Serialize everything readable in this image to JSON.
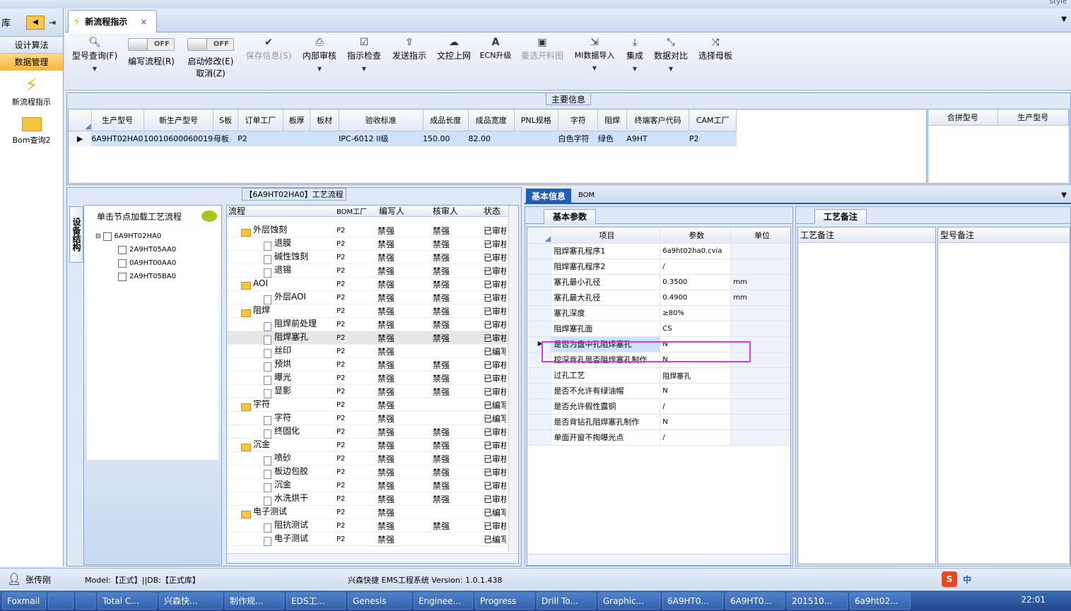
{
  "nav": {
    "top_label": "库",
    "items": [
      "设计算法",
      "数据管理"
    ],
    "tiles": [
      "新流程指示",
      "Bom查询2"
    ]
  },
  "tab": {
    "title": "新流程指示",
    "close": "×"
  },
  "ribbon": {
    "buttons": [
      {
        "label": "型号查询(F)",
        "icon": "search-icon"
      },
      {
        "label": "编写流程(R)",
        "icon": "toggle-off"
      },
      {
        "label": "启动修改(E)",
        "label2": "取消(Z)",
        "icon": "toggle-off"
      },
      {
        "label": "保存信息(S)",
        "icon": "check-icon"
      },
      {
        "label": "内部审核",
        "icon": "print-icon"
      },
      {
        "label": "指示检查",
        "icon": "checkbox-icon"
      },
      {
        "label": "发送指示",
        "icon": "upload-icon"
      },
      {
        "label": "文控上网",
        "icon": "cloud-upload-icon"
      },
      {
        "label": "ECN升级",
        "icon": "font-a-icon"
      },
      {
        "label": "重选开料图",
        "icon": "image-icon"
      },
      {
        "label": "MI数据导入",
        "icon": "import-icon"
      },
      {
        "label": "集成",
        "icon": "download-icon"
      },
      {
        "label": "数据对比",
        "icon": "compress-icon"
      },
      {
        "label": "选择母板",
        "icon": "shuffle-icon"
      }
    ],
    "toggle_off": "OFF"
  },
  "main_info": {
    "title": "主要信息",
    "headers": [
      "生产型号",
      "新生产型号",
      "S板",
      "订单工厂",
      "板厚",
      "板材",
      "验收标准",
      "成品长度",
      "成品宽度",
      "PNL规格",
      "字符",
      "阻焊",
      "终端客户代码",
      "CAM工厂"
    ],
    "row": [
      "6A9HT02HA0",
      "10010600060019",
      "母板",
      "P2",
      "",
      "",
      "IPC-6012 II级",
      "150.00",
      "82.00",
      "",
      "白色字符",
      "绿色",
      "A9HT",
      "P2"
    ],
    "side_headers": [
      "合拼型号",
      "生产型号"
    ]
  },
  "flow": {
    "title": "【6A9HT02HA0】工艺流程",
    "hint": "单击节点加载工艺流程",
    "vtab": "设备结构",
    "tree": [
      "6A9HT02HA0",
      "2A9HT05AA0",
      "0A9HT00AA0",
      "2A9HT05BA0"
    ],
    "headers": [
      "流程",
      "BOM工厂",
      "编写人",
      "核审人",
      "状态"
    ],
    "rows": [
      {
        "n": "外层蚀刻",
        "f": 1,
        "b": "P2",
        "w": "禁强",
        "h": "禁强",
        "s": "已审核"
      },
      {
        "n": "退膜",
        "f": 0,
        "b": "P2",
        "w": "禁强",
        "h": "禁强",
        "s": "已审核"
      },
      {
        "n": "碱性蚀刻",
        "f": 0,
        "b": "P2",
        "w": "禁强",
        "h": "禁强",
        "s": "已审核"
      },
      {
        "n": "退锡",
        "f": 0,
        "b": "P2",
        "w": "禁强",
        "h": "禁强",
        "s": "已审核"
      },
      {
        "n": "AOI",
        "f": 1,
        "b": "P2",
        "w": "禁强",
        "h": "禁强",
        "s": "已审核"
      },
      {
        "n": "外层AOI",
        "f": 0,
        "b": "P2",
        "w": "禁强",
        "h": "禁强",
        "s": "已审核"
      },
      {
        "n": "阻焊",
        "f": 1,
        "b": "P2",
        "w": "禁强",
        "h": "禁强",
        "s": "已审核"
      },
      {
        "n": "阻焊前处理",
        "f": 0,
        "b": "P2",
        "w": "禁强",
        "h": "禁强",
        "s": "已审核"
      },
      {
        "n": "阻焊塞孔",
        "f": 0,
        "b": "P2",
        "w": "禁强",
        "h": "禁强",
        "s": "已审核",
        "sel": 1
      },
      {
        "n": "丝印",
        "f": 0,
        "b": "P2",
        "w": "禁强",
        "h": "",
        "s": "已编写"
      },
      {
        "n": "预烘",
        "f": 0,
        "b": "P2",
        "w": "禁强",
        "h": "禁强",
        "s": "已审核"
      },
      {
        "n": "曝光",
        "f": 0,
        "b": "P2",
        "w": "禁强",
        "h": "禁强",
        "s": "已审核"
      },
      {
        "n": "显影",
        "f": 0,
        "b": "P2",
        "w": "禁强",
        "h": "禁强",
        "s": "已审核"
      },
      {
        "n": "字符",
        "f": 1,
        "b": "P2",
        "w": "禁强",
        "h": "",
        "s": "已编写"
      },
      {
        "n": "字符",
        "f": 0,
        "b": "P2",
        "w": "禁强",
        "h": "",
        "s": "已编写"
      },
      {
        "n": "终固化",
        "f": 0,
        "b": "P2",
        "w": "禁强",
        "h": "禁强",
        "s": "已审核"
      },
      {
        "n": "沉金",
        "f": 1,
        "b": "P2",
        "w": "禁强",
        "h": "禁强",
        "s": "已审核"
      },
      {
        "n": "喷砂",
        "f": 0,
        "b": "P2",
        "w": "禁强",
        "h": "禁强",
        "s": "已审核"
      },
      {
        "n": "板边包胶",
        "f": 0,
        "b": "P2",
        "w": "禁强",
        "h": "禁强",
        "s": "已审核"
      },
      {
        "n": "沉金",
        "f": 0,
        "b": "P2",
        "w": "禁强",
        "h": "禁强",
        "s": "已审核"
      },
      {
        "n": "水洗烘干",
        "f": 0,
        "b": "P2",
        "w": "禁强",
        "h": "禁强",
        "s": "已审核"
      },
      {
        "n": "电子测试",
        "f": 1,
        "b": "P2",
        "w": "禁强",
        "h": "",
        "s": "已编写"
      },
      {
        "n": "阻抗测试",
        "f": 0,
        "b": "P2",
        "w": "禁强",
        "h": "禁强",
        "s": "已审核"
      },
      {
        "n": "电子测试",
        "f": 0,
        "b": "P2",
        "w": "禁强",
        "h": "",
        "s": "已编写"
      }
    ]
  },
  "basic": {
    "tabs": [
      "基本信息",
      "BOM"
    ],
    "subtab": "基本参数",
    "headers": [
      "项目",
      "参数",
      "单位"
    ],
    "rows": [
      [
        "阻焊塞孔程序1",
        "6a9ht02ha0.cvia",
        ""
      ],
      [
        "阻焊塞孔程序2",
        "/",
        ""
      ],
      [
        "塞孔最小孔径",
        "0.3500",
        "mm"
      ],
      [
        "塞孔最大孔径",
        "0.4900",
        "mm"
      ],
      [
        "塞孔深度",
        "≥80%",
        ""
      ],
      [
        "阻焊塞孔面",
        "CS",
        ""
      ],
      [
        "是否为盘中孔阻焊塞孔",
        "N",
        ""
      ],
      [
        "控深背孔是否阻焊塞孔制作",
        "N",
        ""
      ],
      [
        "过孔工艺",
        "阻焊塞孔",
        ""
      ],
      [
        "是否不允许有绿油帽",
        "N",
        ""
      ],
      [
        "是否允许假性露铜",
        "/",
        ""
      ],
      [
        "是否背钻孔阻焊塞孔制作",
        "N",
        ""
      ],
      [
        "单面开窗不掏曝光点",
        "/",
        ""
      ]
    ]
  },
  "remarks": {
    "tab": "工艺备注",
    "col1": "工艺备注",
    "col2": "型号备注"
  },
  "status": {
    "user": "张传刚",
    "model": "Model:【正式】||DB:【正式库】",
    "system": "兴森快捷 EMS工程系统 Version: 1.0.1.438"
  },
  "taskbar": {
    "items": [
      "Foxmail",
      "",
      "",
      "Total C...",
      "兴森快...",
      "制作规...",
      "EDS工...",
      "Genesis",
      "Enginee...",
      "Progress",
      "Drill To...",
      "Graphic...",
      "6A9HT0...",
      "6A9HT0...",
      "201510...",
      "6a9ht02..."
    ],
    "time": "22:01",
    "ime": "中"
  },
  "style_label": "Style"
}
